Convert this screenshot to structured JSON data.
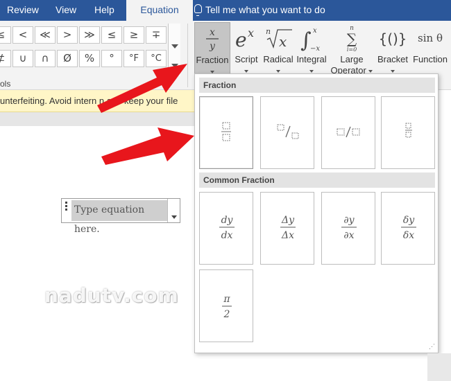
{
  "tabs": [
    {
      "label": "Review"
    },
    {
      "label": "View"
    },
    {
      "label": "Help"
    },
    {
      "label": "Equation"
    }
  ],
  "tell_me": "Tell me what you want to do",
  "symbols": {
    "row1": [
      "≤",
      "<",
      "≪",
      ">",
      "≫",
      "≤",
      "≥",
      "∓"
    ],
    "row2": [
      "⊄",
      "∪",
      "∩",
      "Ø",
      "%",
      "°",
      "°F",
      "°C"
    ],
    "group_label": "ols"
  },
  "tools": {
    "fraction": {
      "label": "Fraction"
    },
    "script": {
      "label": "Script"
    },
    "radical": {
      "label": "Radical"
    },
    "integral": {
      "label": "Integral"
    },
    "large_operator": {
      "label_1": "Large",
      "label_2": "Operator"
    },
    "bracket": {
      "label": "Bracket"
    },
    "function": {
      "label": "Function"
    },
    "function_icon": "sin θ"
  },
  "notification": "unterfeiting. Avoid intern     n and keep your file",
  "equation_placeholder": "Type equation here.",
  "gallery": {
    "section_fraction": "Fraction",
    "section_common": "Common Fraction",
    "common": [
      {
        "num": "dy",
        "den": "dx"
      },
      {
        "num": "Δy",
        "den": "Δx"
      },
      {
        "num": "∂y",
        "den": "∂x"
      },
      {
        "num": "δy",
        "den": "δx"
      },
      {
        "num": "π",
        "den": "2"
      }
    ]
  },
  "watermark": "nadutv.com",
  "colors": {
    "ribbon_blue": "#2b579a",
    "arrow_red": "#e8161c"
  }
}
